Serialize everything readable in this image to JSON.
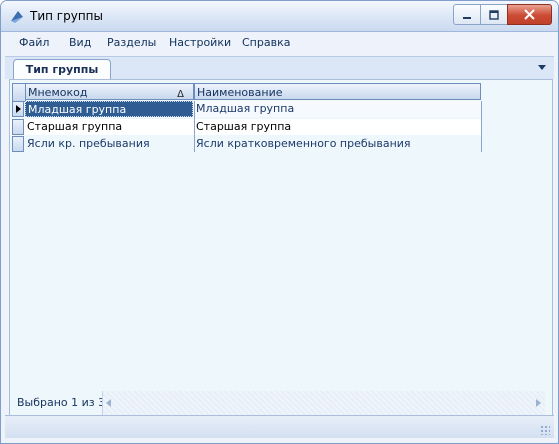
{
  "window": {
    "title": "Тип группы",
    "icon": "app-icon",
    "controls": [
      "minimize-icon",
      "maximize-icon",
      "close-icon"
    ]
  },
  "menu": {
    "items": [
      "Файл",
      "Вид",
      "Разделы",
      "Настройки",
      "Справка"
    ]
  },
  "tabs": {
    "active_label": "Тип группы"
  },
  "grid": {
    "columns": [
      "Мнемокод",
      "Наименование"
    ],
    "sort_indicator": "Δ",
    "rows": [
      [
        "Младшая группа",
        "Младшая группа"
      ],
      [
        "Старшая группа",
        "Старшая группа"
      ],
      [
        "Ясли кр. пребывания",
        "Ясли кратковременного пребывания"
      ]
    ],
    "status": "Выбрано 1 из 3"
  },
  "colors": {
    "selection": "#2f5d93",
    "header_text": "#15325e",
    "close_button": "#cc4a34"
  }
}
